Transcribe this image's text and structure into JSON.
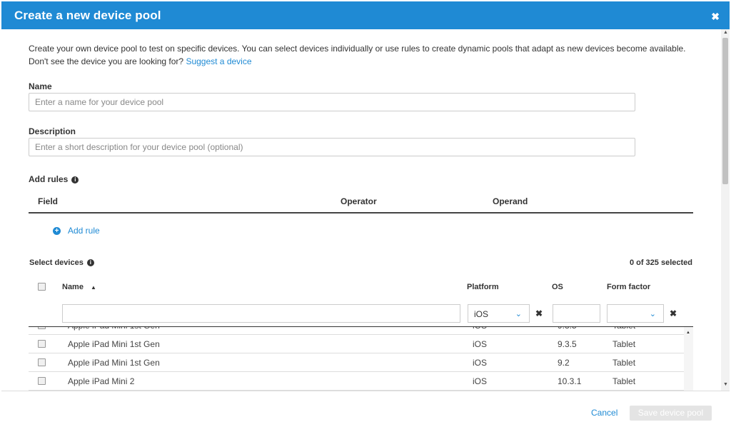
{
  "dialog": {
    "title": "Create a new device pool",
    "close_glyph": "✖"
  },
  "intro": {
    "text": "Create your own device pool to test on specific devices. You can select devices individually or use rules to create dynamic pools that adapt as new devices become available. Don't see the device you are looking for?",
    "link": "Suggest a device"
  },
  "name_field": {
    "label": "Name",
    "placeholder": "Enter a name for your device pool",
    "value": ""
  },
  "description_field": {
    "label": "Description",
    "placeholder": "Enter a short description for your device pool (optional)",
    "value": ""
  },
  "rules": {
    "label": "Add rules",
    "columns": [
      "Field",
      "Operator",
      "Operand"
    ],
    "add_rule_label": "Add rule"
  },
  "devices": {
    "label": "Select devices",
    "selected_count": "0 of 325 selected",
    "columns": {
      "name": "Name",
      "platform": "Platform",
      "os": "OS",
      "form_factor": "Form factor"
    },
    "filters": {
      "name": "",
      "platform": "iOS",
      "os": "",
      "form_factor": ""
    },
    "rows": [
      {
        "name": "Apple iPad Mini 1st Gen",
        "platform": "iOS",
        "os": "9.3.5",
        "form_factor": "Tablet"
      },
      {
        "name": "Apple iPad Mini 1st Gen",
        "platform": "iOS",
        "os": "9.2",
        "form_factor": "Tablet"
      },
      {
        "name": "Apple iPad Mini 2",
        "platform": "iOS",
        "os": "10.3.1",
        "form_factor": "Tablet"
      }
    ]
  },
  "footer": {
    "cancel_label": "Cancel",
    "save_label": "Save device pool"
  },
  "icons": {
    "info": "i",
    "plus": "+",
    "sort_up": "▲",
    "chevron_down": "⌄",
    "clear": "✖",
    "scroll_up": "▲",
    "scroll_down": "▼"
  },
  "colors": {
    "header": "#1f8ad4",
    "link": "#1f8ad4"
  }
}
